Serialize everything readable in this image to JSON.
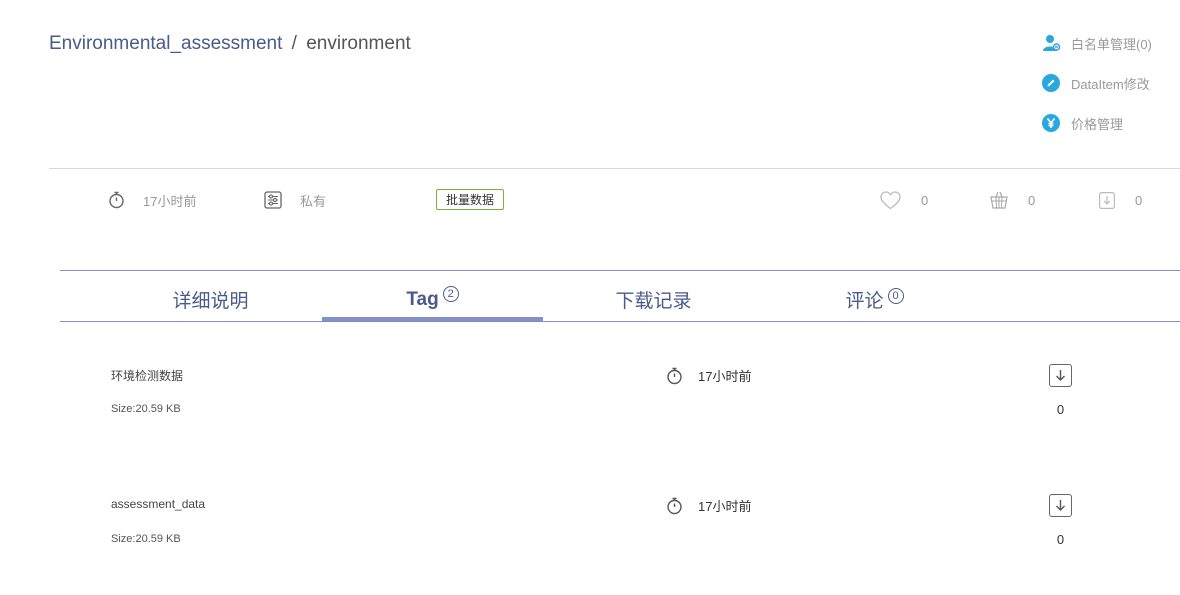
{
  "breadcrumb": {
    "parent": "Environmental_assessment",
    "separator": "/",
    "current": "environment"
  },
  "side_actions": [
    {
      "label": "白名单管理(0)",
      "icon": "user-group-icon"
    },
    {
      "label": "DataItem修改",
      "icon": "pencil-icon"
    },
    {
      "label": "价格管理",
      "icon": "yen-icon"
    }
  ],
  "meta": {
    "time": "17小时前",
    "visibility": "私有",
    "badge": "批量数据"
  },
  "stats": {
    "likes": "0",
    "cart": "0",
    "downloads": "0"
  },
  "tabs": [
    {
      "label": "详细说明",
      "count": ""
    },
    {
      "label": "Tag",
      "count": "2"
    },
    {
      "label": "下载记录",
      "count": ""
    },
    {
      "label": "评论",
      "count": "0"
    }
  ],
  "files": [
    {
      "name": "环境检测数据",
      "size": "Size:20.59 KB",
      "time": "17小时前",
      "downloads": "0"
    },
    {
      "name": "assessment_data",
      "size": "Size:20.59 KB",
      "time": "17小时前",
      "downloads": "0"
    }
  ],
  "colors": {
    "accent": "#4a5a8a",
    "icon_blue": "#29a8e0",
    "badge_border": "#7ab23a",
    "tab_indicator": "#8193c6"
  }
}
